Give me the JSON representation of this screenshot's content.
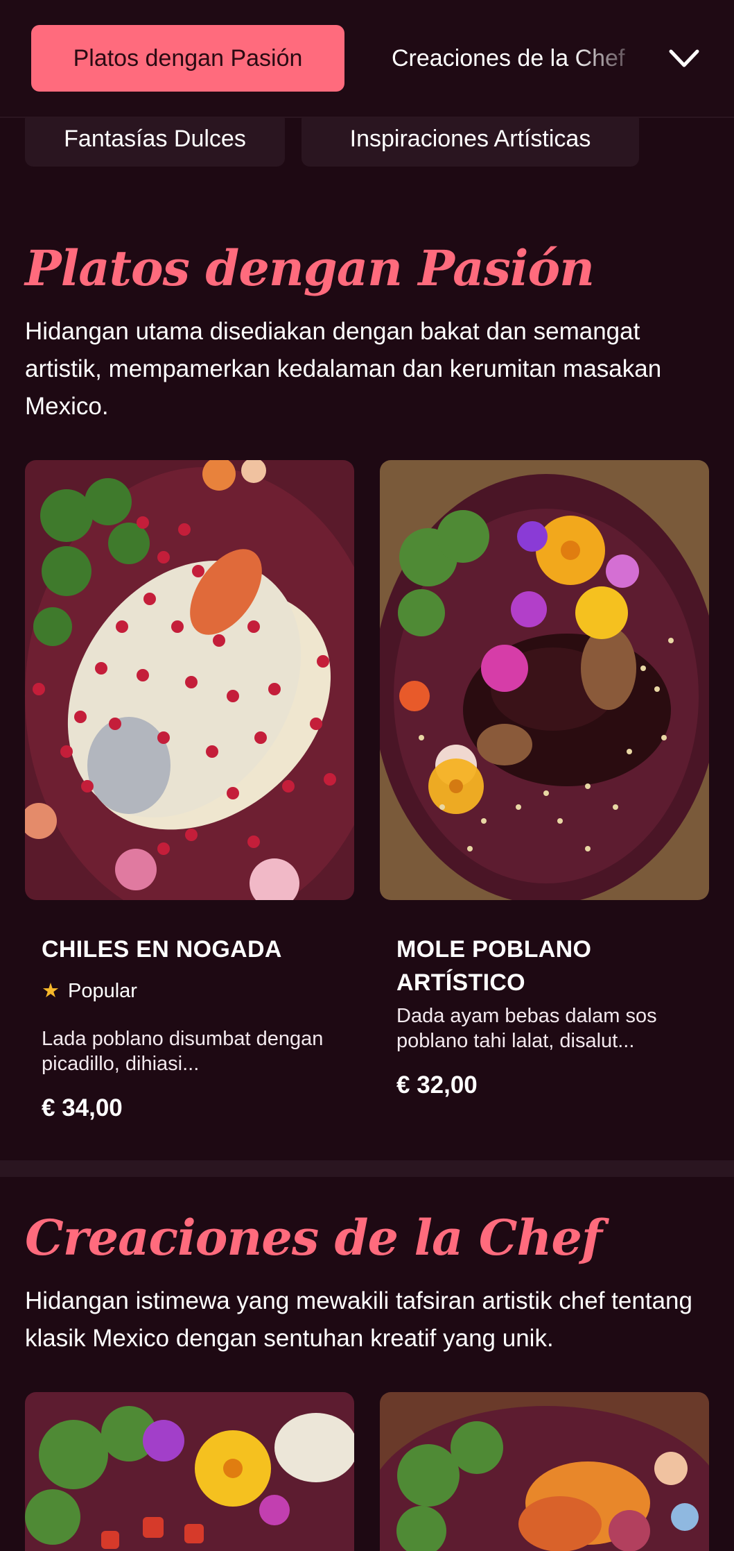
{
  "category_nav": {
    "active": "Platos dengan Pasión",
    "next": "Creaciones de la Chef",
    "more_icon": "chevron-down-icon",
    "row2": [
      "Fantasías Dulces",
      "Inspiraciones Artísticas"
    ]
  },
  "sections": [
    {
      "title": "Platos dengan Pasión",
      "description": "Hidangan utama disediakan dengan bakat dan semangat artistik, mempamerkan kedalaman dan kerumitan masakan Mexico.",
      "dishes": [
        {
          "name": "CHILES EN NOGADA",
          "badge": "Popular",
          "badge_icon": "star-icon",
          "description": "Lada poblano disumbat dengan picadillo, dihiasi...",
          "price": "€ 34,00"
        },
        {
          "name": "MOLE POBLANO ARTÍSTICO",
          "description": "Dada ayam bebas dalam sos poblano tahi lalat, disalut...",
          "price": "€ 32,00"
        }
      ]
    },
    {
      "title": "Creaciones de la Chef",
      "description": "Hidangan istimewa yang mewakili tafsiran artistik chef tentang klasik Mexico dengan sentuhan kreatif yang unik."
    }
  ],
  "colors": {
    "background": "#1e0913",
    "accent": "#ff6b7d",
    "pill": "#2a1520",
    "star": "#f7b82b"
  }
}
